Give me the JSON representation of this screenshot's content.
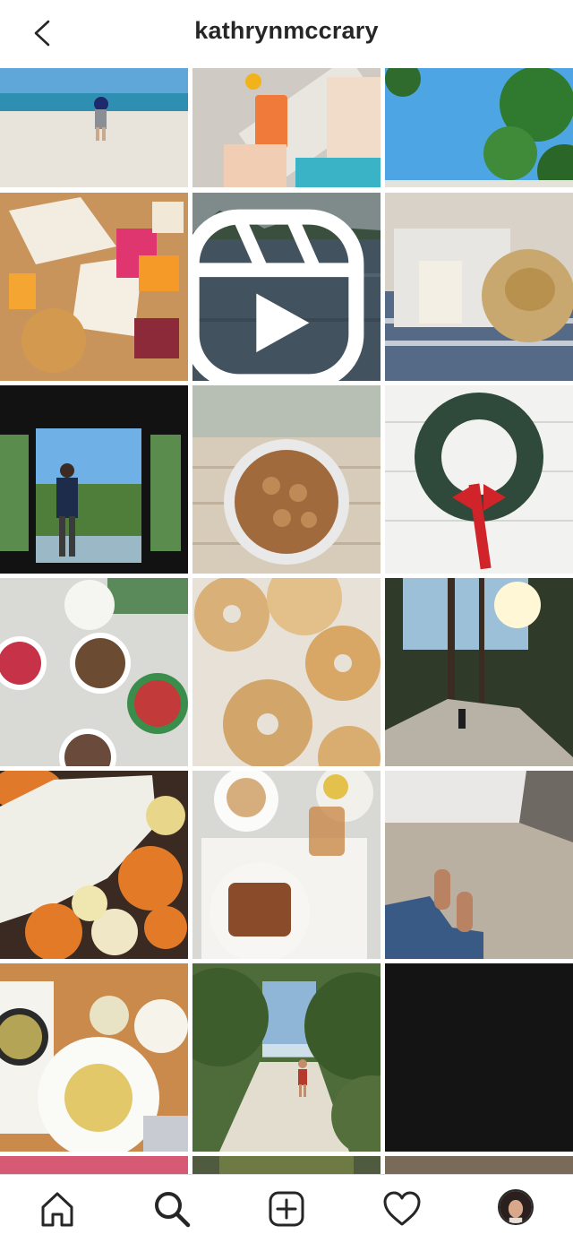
{
  "header": {
    "username": "kathrynmccrary",
    "back_icon": "chevron-left-icon"
  },
  "grid": {
    "posts": [
      {
        "subject": "child-on-beach",
        "type": "photo"
      },
      {
        "subject": "cocktail-on-beach",
        "type": "photo"
      },
      {
        "subject": "tree-and-sky",
        "type": "photo"
      },
      {
        "subject": "food-platter",
        "type": "photo"
      },
      {
        "subject": "lake-with-hills",
        "type": "reel"
      },
      {
        "subject": "book-and-straw-hat",
        "type": "photo"
      },
      {
        "subject": "man-at-window",
        "type": "photo"
      },
      {
        "subject": "bowl-of-peanuts",
        "type": "photo"
      },
      {
        "subject": "christmas-wreath",
        "type": "photo"
      },
      {
        "subject": "ice-cream-tubs",
        "type": "photo"
      },
      {
        "subject": "bagels",
        "type": "photo"
      },
      {
        "subject": "sunlit-forest-path",
        "type": "photo"
      },
      {
        "subject": "pumpkins-and-flowers",
        "type": "photo"
      },
      {
        "subject": "cafe-breakfast",
        "type": "photo"
      },
      {
        "subject": "feet-on-ground",
        "type": "photo"
      },
      {
        "subject": "pasta-dinner",
        "type": "photo"
      },
      {
        "subject": "beach-path-child",
        "type": "photo"
      },
      {
        "subject": "dark-image",
        "type": "photo"
      }
    ]
  },
  "bottom_nav": {
    "items": [
      "home-icon",
      "search-icon",
      "new-post-icon",
      "heart-icon",
      "profile-avatar"
    ],
    "active": "search-icon"
  },
  "colors": {
    "text": "#262626",
    "divider": "#dbdbdb",
    "background": "#ffffff"
  }
}
